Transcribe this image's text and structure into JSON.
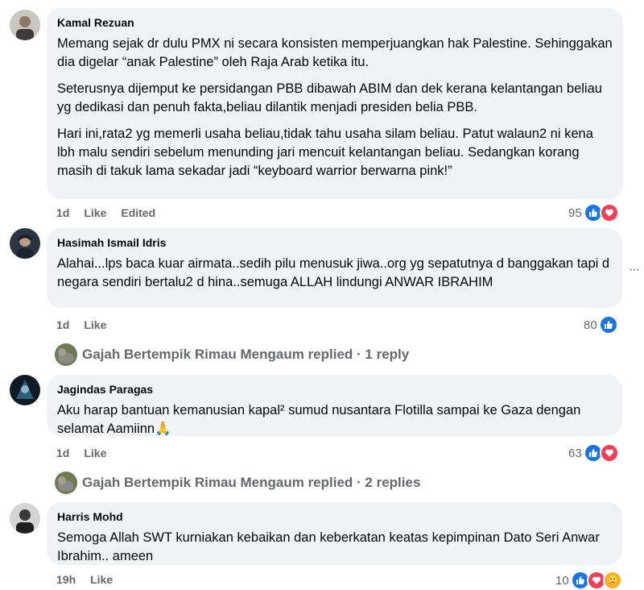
{
  "comments": [
    {
      "author": "Kamal Rezuan",
      "paragraphs": [
        "Memang sejak dr dulu PMX ni secara konsisten memperjuangkan hak Palestine. Sehinggakan dia digelar “anak Palestine” oleh Raja Arab ketika itu.",
        "Seterusnya dijemput ke persidangan PBB dibawah ABIM dan dek kerana kelantangan beliau yg dedikasi dan penuh fakta,beliau dilantik menjadi presiden belia PBB.",
        "Hari ini,rata2 yg memerli usaha beliau,tidak tahu usaha silam beliau. Patut walaun2 ni kena lbh malu sendiri sebelum menunding jari mencuit kelantangan beliau. Sedangkan korang masih di takuk lama sekadar jadi “keyboard warrior berwarna pink!”"
      ],
      "time": "1d",
      "like": "Like",
      "edited": "Edited",
      "reaction_count": "95"
    },
    {
      "author": "Hasimah Ismail Idris",
      "paragraphs": [
        "Alahai...lps baca kuar airmata..sedih pilu menusuk jiwa..org yg sepatutnya d banggakan tapi d negara sendiri bertalu2 d hina..semuga ALLAH lindungi ANWAR IBRAHIM"
      ],
      "time": "1d",
      "like": "Like",
      "reaction_count": "80",
      "replied": "Gajah Bertempik Rimau Mengaum replied · 1 reply"
    },
    {
      "author": "Jagindas Paragas",
      "paragraphs": [
        "Aku harap bantuan kemanusian kapal² sumud nusantara Flotilla sampai ke Gaza dengan selamat Aamiinn🙏"
      ],
      "time": "1d",
      "like": "Like",
      "reaction_count": "63",
      "replied": "Gajah Bertempik Rimau Mengaum replied · 2 replies"
    },
    {
      "author": "Harris Mohd",
      "paragraphs": [
        "Semoga Allah SWT kurniakan kebaikan dan keberkatan keatas kepimpinan Dato Seri Anwar Ibrahim.. ameen"
      ],
      "time": "19h",
      "like": "Like",
      "reaction_count": "10"
    }
  ],
  "icons": {
    "like": "like-reaction-icon",
    "love": "love-reaction-icon",
    "care": "care-reaction-icon",
    "more": "more-options-icon"
  },
  "colors": {
    "bubble": "#f0f2f5",
    "meta": "#65676b",
    "like_blue": "#1b74e4",
    "love_red": "#f33e58",
    "care_yellow": "#f7b125"
  }
}
